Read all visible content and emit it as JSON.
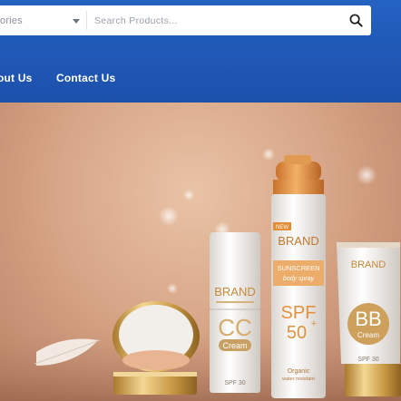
{
  "search": {
    "category_text": "ories",
    "placeholder": "Search Products..."
  },
  "nav": {
    "items": [
      {
        "label": "out Us"
      },
      {
        "label": "Contact Us"
      }
    ]
  },
  "hero": {
    "tube_spray": {
      "brand": "BRAND",
      "line1": "SUNSCREEN",
      "line2": "body spray",
      "spf": "SPF",
      "spf_value": "50",
      "plus": "+",
      "foot1": "Organic",
      "foot2": "water resistant"
    },
    "bottle_cc": {
      "brand": "BRAND",
      "big": "CC",
      "label": "Cream",
      "spf": "SPF 30"
    },
    "tube_bb": {
      "brand": "BRAND",
      "big": "BB",
      "label": "Cream",
      "spf": "SPF 30"
    },
    "new_tag": "NEW"
  }
}
